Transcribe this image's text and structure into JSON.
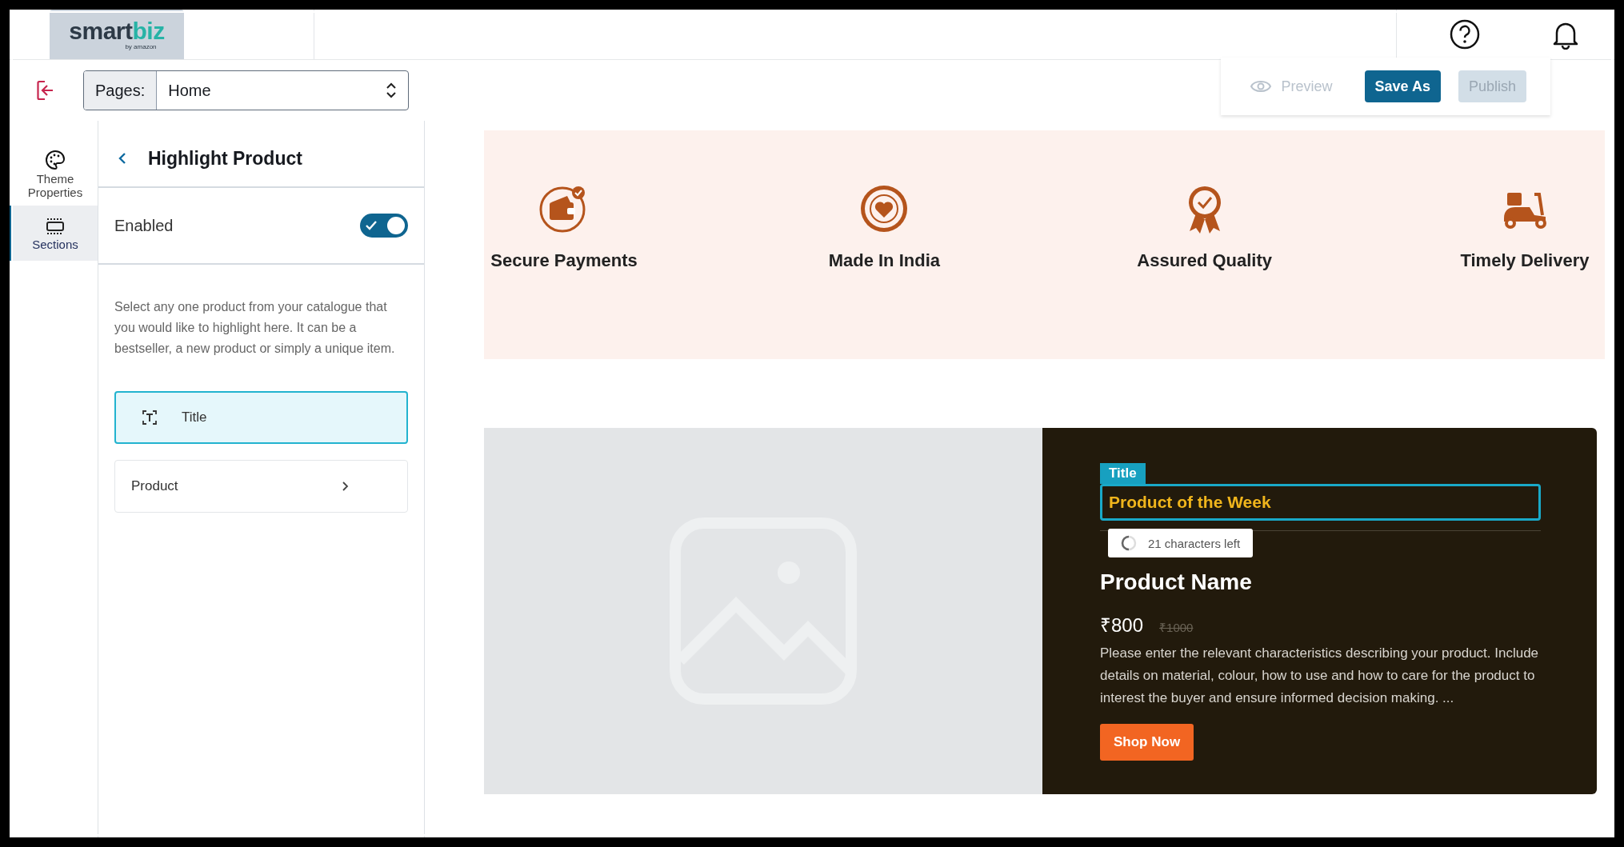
{
  "logo": {
    "name_dark": "smart",
    "name_accent": "biz",
    "byline": "by amazon"
  },
  "toolbar": {
    "pages_label": "Pages:",
    "page_value": "Home",
    "preview": "Preview",
    "buttons": [
      {
        "label": "Save As",
        "disabled": false
      },
      {
        "label": "Publish",
        "disabled": true
      }
    ]
  },
  "rail": [
    {
      "kind": "palette",
      "label": "Theme Properties",
      "selected": false
    },
    {
      "kind": "sections",
      "label": "Sections",
      "selected": true
    }
  ],
  "panel": {
    "title": "Highlight Product",
    "toggle": {
      "label": "Enabled",
      "on": true
    },
    "description": "Select any one product from your catalogue that you would like to highlight here. It can be a bestseller, a new product or simply a unique item.",
    "items": [
      {
        "kind": "title",
        "label": "Title",
        "selected": true
      },
      {
        "kind": "product",
        "label": "Product",
        "selected": false
      }
    ]
  },
  "features": [
    {
      "kind": "wallet",
      "label": "Secure Payments"
    },
    {
      "kind": "seal",
      "label": "Made In India"
    },
    {
      "kind": "ribbon",
      "label": "Assured Quality"
    },
    {
      "kind": "scooter",
      "label": "Timely Delivery"
    }
  ],
  "product": {
    "title_tag": "Title",
    "title_value": "Product of the Week",
    "chars_left": "21 characters left",
    "name": "Product Name",
    "price": "₹800",
    "old_price": "₹1000",
    "description": "Please enter the relevant characteristics describing your product. Include details on material, colour, how to use and how to care for the product to interest the buyer and ensure informed decision making. ...",
    "button": "Shop Now"
  }
}
